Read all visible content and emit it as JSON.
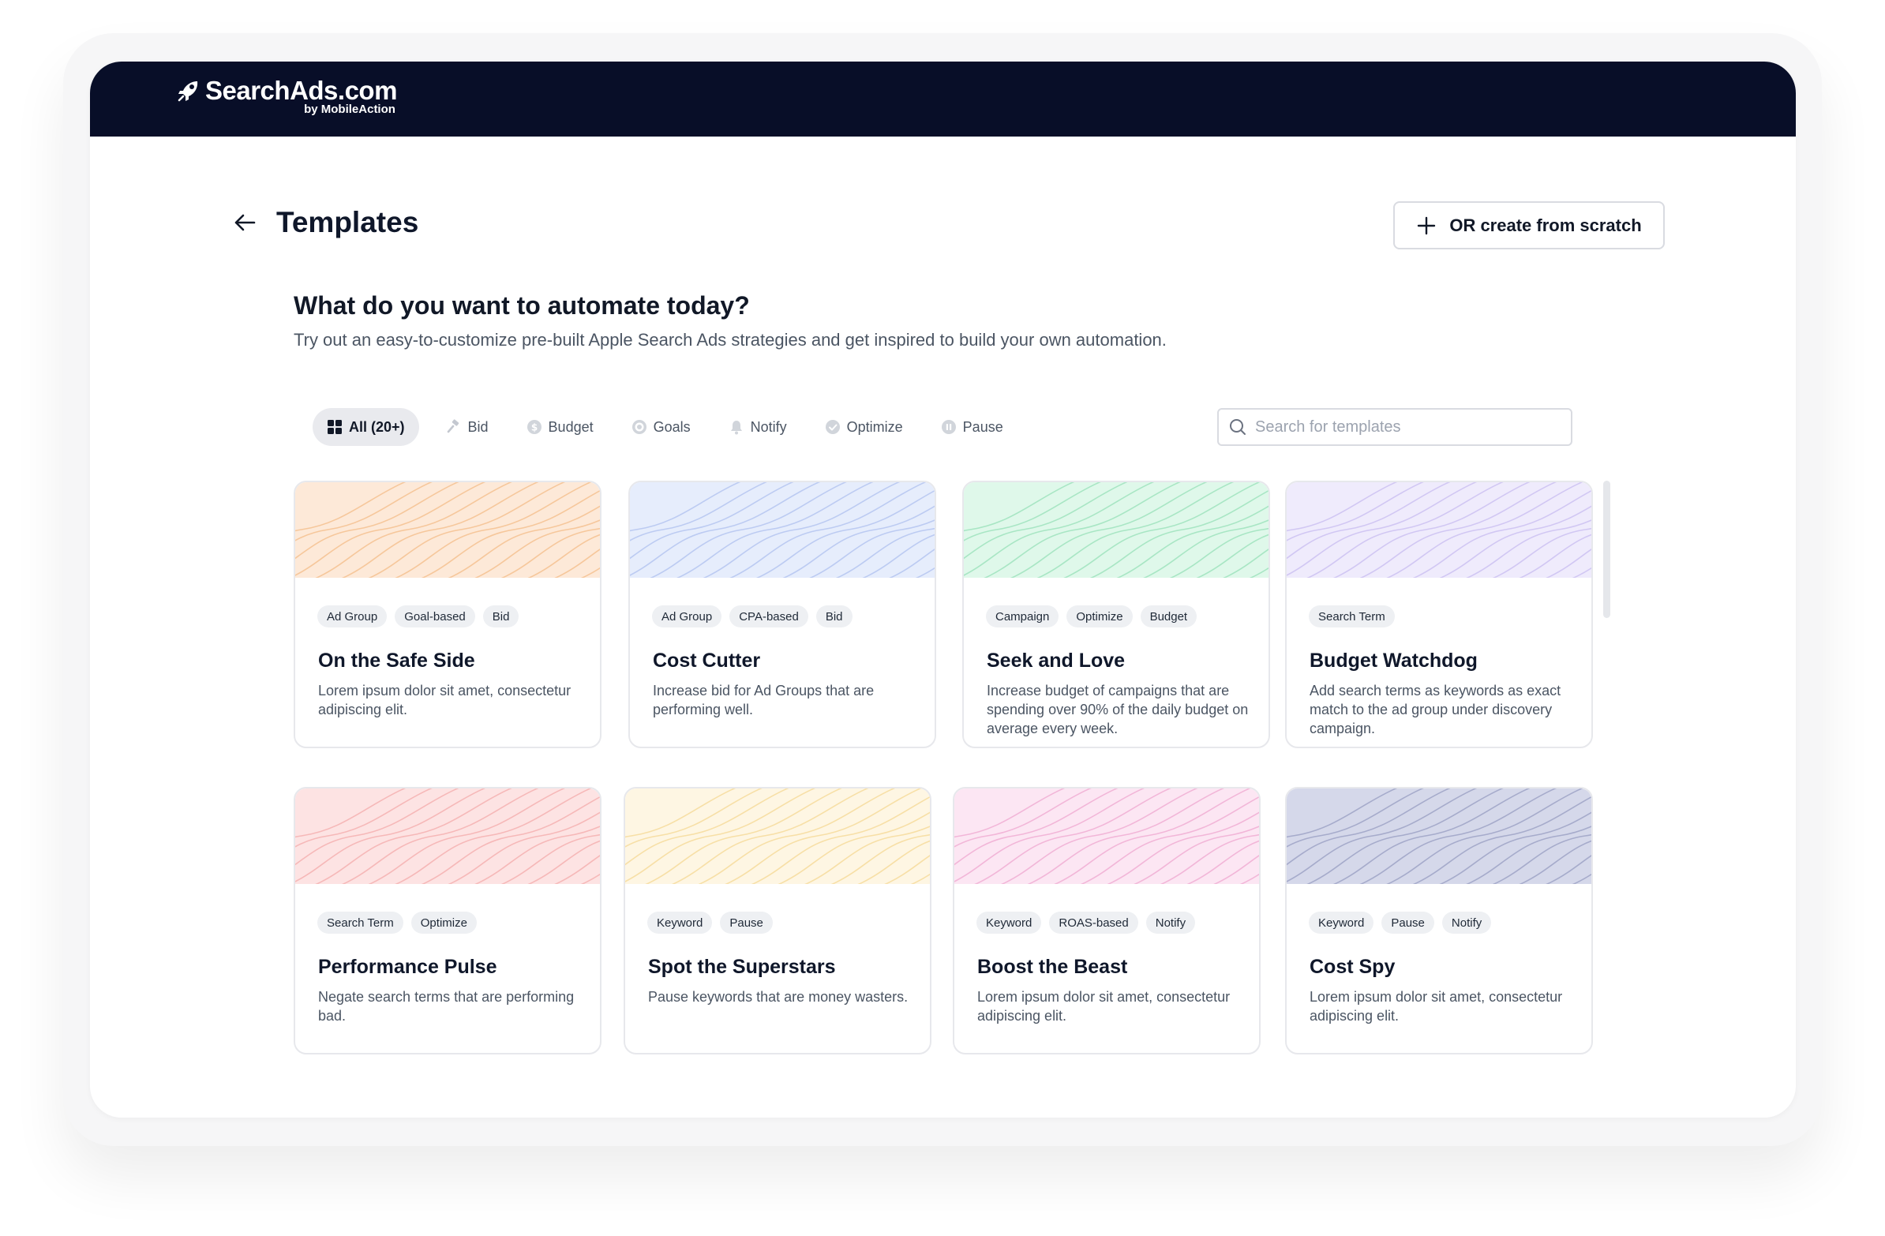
{
  "brand": {
    "name": "SearchAds.com",
    "by": "by MobileAction"
  },
  "page": {
    "title": "Templates",
    "create_label": "OR create from scratch"
  },
  "intro": {
    "headline": "What do you want to automate today?",
    "subline": "Try out an easy-to-customize pre-built Apple Search Ads strategies and get inspired to build your own automation."
  },
  "filters": [
    {
      "label": "All (20+)",
      "icon": "grid-icon",
      "active": true
    },
    {
      "label": "Bid",
      "icon": "gavel-icon",
      "active": false
    },
    {
      "label": "Budget",
      "icon": "dollar-icon",
      "active": false
    },
    {
      "label": "Goals",
      "icon": "target-icon",
      "active": false
    },
    {
      "label": "Notify",
      "icon": "bell-icon",
      "active": false
    },
    {
      "label": "Optimize",
      "icon": "check-circle-icon",
      "active": false
    },
    {
      "label": "Pause",
      "icon": "pause-icon",
      "active": false
    }
  ],
  "search": {
    "placeholder": "Search for templates",
    "value": ""
  },
  "cards": [
    {
      "title": "On the Safe Side",
      "tags": [
        "Ad Group",
        "Goal-based",
        "Bid"
      ],
      "desc": "Lorem ipsum dolor sit amet, consectetur adipiscing elit.",
      "bg": "#fde9d8",
      "line": "#f6c79b"
    },
    {
      "title": "Cost Cutter",
      "tags": [
        "Ad Group",
        "CPA-based",
        "Bid"
      ],
      "desc": "Increase bid for Ad Groups that are performing well.",
      "bg": "#e6edfc",
      "line": "#bccbf2"
    },
    {
      "title": "Seek and Love",
      "tags": [
        "Campaign",
        "Optimize",
        "Budget"
      ],
      "desc": "Increase budget of campaigns that are spending over 90% of the daily budget on average every week.",
      "bg": "#dff8ea",
      "line": "#a8e6c4"
    },
    {
      "title": "Budget Watchdog",
      "tags": [
        "Search Term"
      ],
      "desc": "Add search terms as keywords as exact match to the ad group under discovery campaign.",
      "bg": "#efebfc",
      "line": "#d1c7f3"
    },
    {
      "title": "Performance Pulse",
      "tags": [
        "Search Term",
        "Optimize"
      ],
      "desc": "Negate search terms that are performing bad.",
      "bg": "#fde3e3",
      "line": "#f6b8b8"
    },
    {
      "title": "Spot the Superstars",
      "tags": [
        "Keyword",
        "Pause"
      ],
      "desc": "Pause keywords that are money wasters.",
      "bg": "#fef6e3",
      "line": "#f7dfa6"
    },
    {
      "title": "Boost the Beast",
      "tags": [
        "Keyword",
        "ROAS-based",
        "Notify"
      ],
      "desc": "Lorem ipsum dolor sit amet, consectetur adipiscing elit.",
      "bg": "#fce6f3",
      "line": "#f2b6d8"
    },
    {
      "title": "Cost Spy",
      "tags": [
        "Keyword",
        "Pause",
        "Notify"
      ],
      "desc": "Lorem ipsum dolor sit amet, consectetur adipiscing elit.",
      "bg": "#d5d8ea",
      "line": "#a6abcb"
    }
  ]
}
